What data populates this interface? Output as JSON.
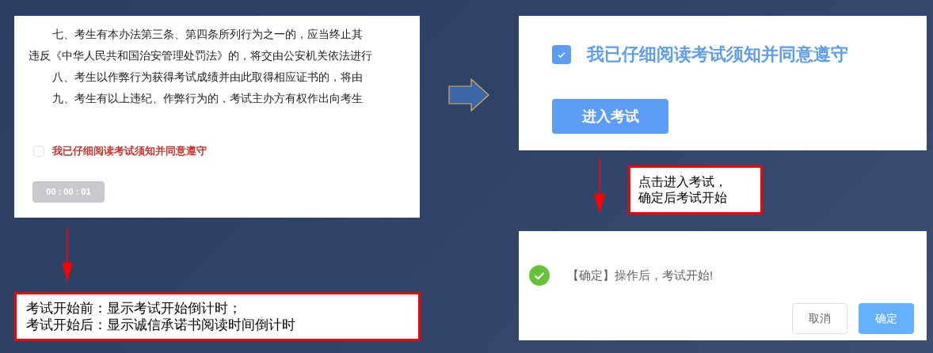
{
  "notice_panel": {
    "paragraphs": [
      {
        "indented": true,
        "text": "七、考生有本办法第三条、第四条所列行为之一的，应当终止其"
      },
      {
        "indented": false,
        "text": "违反《中华人民共和国治安管理处罚法》的，将交由公安机关依法进行"
      },
      {
        "indented": true,
        "text": "八、考生以作弊行为获得考试成绩并由此取得相应证书的，将由"
      },
      {
        "indented": true,
        "text": "九、考生有以上违纪、作弊行为的，考试主办方有权作出向考生"
      }
    ],
    "agreement": {
      "label": "我已仔细阅读考试须知并同意遵守",
      "checked": false
    },
    "countdown_button": {
      "label": "00 : 00 : 01",
      "disabled": true
    }
  },
  "agreed_panel": {
    "agreement": {
      "label": "我已仔细阅读考试须知并同意遵守",
      "checked": true
    },
    "enter_button": {
      "label": "进入考试",
      "disabled": false
    }
  },
  "confirm_dialog": {
    "message": "【确定】操作后，考试开始!",
    "buttons": [
      {
        "label": "取消",
        "kind": "secondary"
      },
      {
        "label": "确定",
        "kind": "primary"
      }
    ]
  },
  "callouts": [
    {
      "lines": [
        "点击进入考试，",
        "确定后考试开始"
      ]
    },
    {
      "lines": [
        "考试开始前：显示考试开始倒计时；",
        "考试开始后：显示诚信承诺书阅读时间倒计时"
      ]
    }
  ]
}
